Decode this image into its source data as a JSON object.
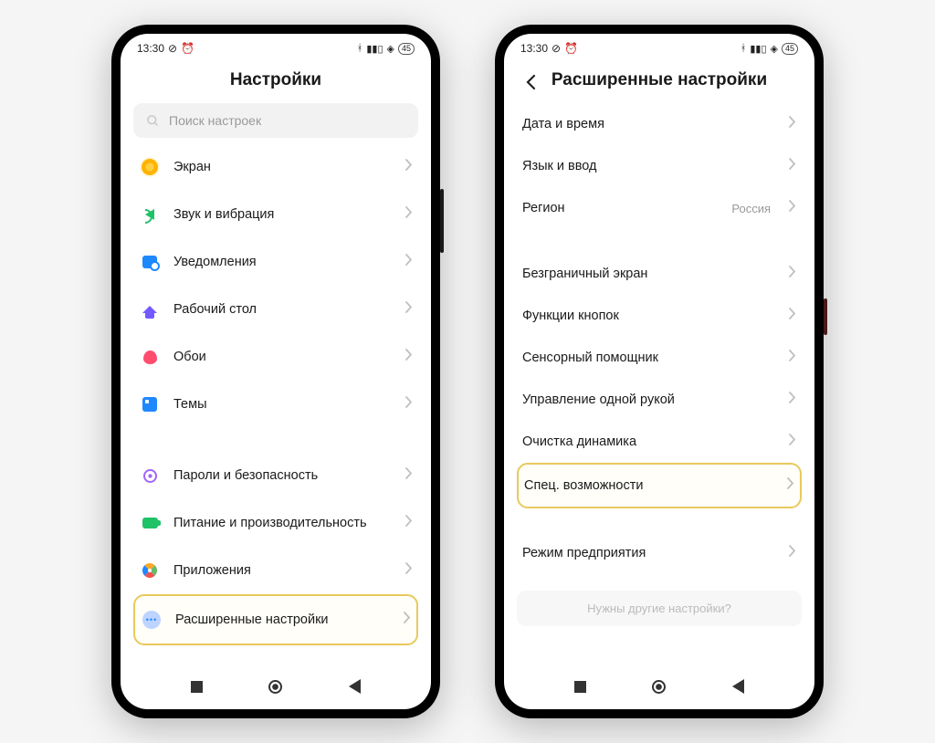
{
  "status": {
    "time": "13:30",
    "battery": "45"
  },
  "phone1": {
    "title": "Настройки",
    "search_placeholder": "Поиск настроек",
    "rows": {
      "display": "Экран",
      "sound": "Звук и вибрация",
      "notif": "Уведомления",
      "home": "Рабочий стол",
      "wall": "Обои",
      "theme": "Темы",
      "lock": "Пароли и безопасность",
      "power": "Питание и производительность",
      "apps": "Приложения",
      "more": "Расширенные настройки"
    }
  },
  "phone2": {
    "title": "Расширенные настройки",
    "rows": {
      "date": "Дата и время",
      "lang": "Язык и ввод",
      "region": "Регион",
      "region_value": "Россия",
      "fullscreen": "Безграничный экран",
      "buttons": "Функции кнопок",
      "quickball": "Сенсорный помощник",
      "onehand": "Управление одной рукой",
      "speaker": "Очистка динамика",
      "access": "Спец. возможности",
      "enterprise": "Режим предприятия",
      "other": "Нужны другие настройки?"
    }
  }
}
